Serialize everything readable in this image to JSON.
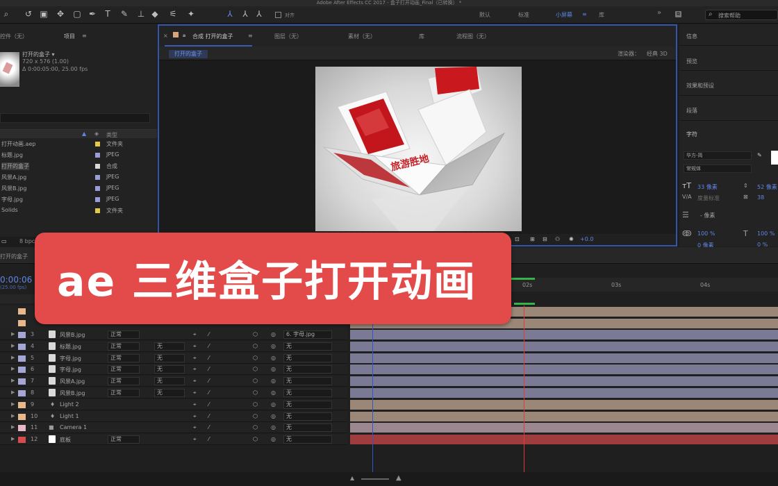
{
  "titlebar": {
    "text": "Adobe After Effects CC 2017 - 盒子打开动画_Final（已转换） *"
  },
  "toolbar": {
    "snap_label": "对齐",
    "workspaces": [
      "默认",
      "标准",
      "小屏幕",
      "库"
    ],
    "active_workspace": "小屏幕",
    "search_placeholder": "搜索帮助"
  },
  "project": {
    "tab_effects": "控件（无）",
    "tab_project": "项目",
    "comp_name": "打开的盒子 ▾",
    "comp_size": "720 x 576 (1.00)",
    "comp_duration": "Δ 0:00:05:00, 25.00 fps",
    "type_header": "类型",
    "items": [
      {
        "name": "打开动画.aep",
        "type": "文件夹",
        "color": "#e2c94a"
      },
      {
        "name": "标题.jpg",
        "type": "JPEG",
        "color": "#9b9bd6"
      },
      {
        "name": "打开的盒子",
        "type": "合成",
        "color": "#d8d8d8",
        "selected": true
      },
      {
        "name": "风景A.jpg",
        "type": "JPEG",
        "color": "#9b9bd6"
      },
      {
        "name": "风景B.jpg",
        "type": "JPEG",
        "color": "#9b9bd6"
      },
      {
        "name": "字母.jpg",
        "type": "JPEG",
        "color": "#9b9bd6"
      },
      {
        "name": "Solids",
        "type": "文件夹",
        "color": "#e2c94a"
      }
    ],
    "bpc": "8 bpc"
  },
  "comp": {
    "tab_comp": "合成 打开的盒子",
    "tab_layer": "图层（无）",
    "tab_footage": "素材（无）",
    "tab_library": "库",
    "tab_flowchart": "流程图（无）",
    "breadcrumb": "打开的盒子",
    "renderer_label": "渲染器：",
    "renderer_value": "经典 3D",
    "exposure": "+0.0",
    "box_text": "旅游胜地"
  },
  "right": {
    "info": "信息",
    "preview": "预览",
    "effects": "效果和预设",
    "paragraph": "段落",
    "character": "字符",
    "font": "华方-简",
    "style": "常规体",
    "font_size": "33 像素",
    "leading": "52 像素",
    "kerning": "度量标准",
    "tracking": "38",
    "stroke": "- 像素",
    "vscale": "100 %",
    "hscale": "100 %",
    "baseline": "0 像素",
    "tsume": "0 %"
  },
  "banner": {
    "text": "ae 三维盒子打开动画"
  },
  "timeline": {
    "comp_tab": "打开的盒子",
    "timecode": "0:00:06",
    "fps_note": "(25.00 fps)",
    "ticks": [
      "02s",
      "03s",
      "04s"
    ],
    "layers": [
      {
        "num": "3",
        "name": "风景B.jpg",
        "color": "#a6a6d6",
        "mode": "正常",
        "mask": "",
        "parent": "6. 字母.jpg",
        "type": "img"
      },
      {
        "num": "4",
        "name": "标题.jpg",
        "color": "#a6a6d6",
        "mode": "正常",
        "mask": "无",
        "parent": "无",
        "type": "img"
      },
      {
        "num": "5",
        "name": "字母.jpg",
        "color": "#a6a6d6",
        "mode": "正常",
        "mask": "无",
        "parent": "无",
        "type": "img"
      },
      {
        "num": "6",
        "name": "字母.jpg",
        "color": "#a6a6d6",
        "mode": "正常",
        "mask": "无",
        "parent": "无",
        "type": "img"
      },
      {
        "num": "7",
        "name": "风景A.jpg",
        "color": "#a6a6d6",
        "mode": "正常",
        "mask": "无",
        "parent": "无",
        "type": "img"
      },
      {
        "num": "8",
        "name": "风景B.jpg",
        "color": "#a6a6d6",
        "mode": "正常",
        "mask": "无",
        "parent": "无",
        "type": "img"
      },
      {
        "num": "9",
        "name": "Light 2",
        "color": "#e6b88a",
        "mode": "",
        "mask": "",
        "parent": "无",
        "type": "light"
      },
      {
        "num": "10",
        "name": "Light 1",
        "color": "#e6b88a",
        "mode": "",
        "mask": "",
        "parent": "无",
        "type": "light"
      },
      {
        "num": "11",
        "name": "Camera 1",
        "color": "#e6b8c8",
        "mode": "",
        "mask": "",
        "parent": "无",
        "type": "camera"
      },
      {
        "num": "12",
        "name": "底板",
        "color": "#d64b4b",
        "mode": "正常",
        "mask": "",
        "parent": "无",
        "type": "solid"
      }
    ]
  }
}
